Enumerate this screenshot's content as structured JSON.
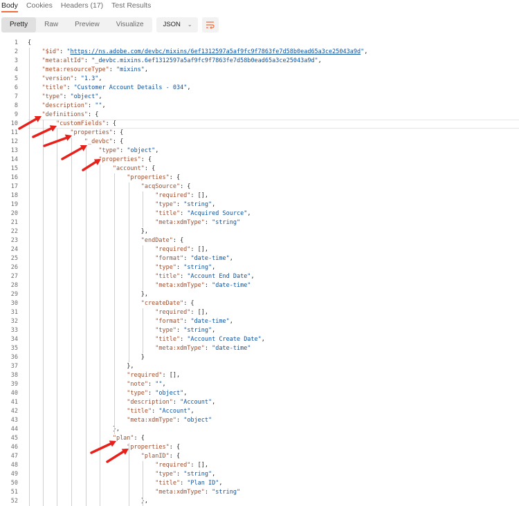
{
  "tabs": [
    "Body",
    "Cookies",
    "Headers (17)",
    "Test Results"
  ],
  "view_modes": [
    "Pretty",
    "Raw",
    "Preview",
    "Visualize"
  ],
  "format": "JSON",
  "colors": {
    "accent": "#f26b3a",
    "arrow": "#e8201a",
    "key": "#a14b2a",
    "string": "#0b52a1"
  },
  "lines": [
    [
      {
        "c": "p",
        "t": "{"
      }
    ],
    [
      {
        "c": "p",
        "t": "    "
      },
      {
        "c": "k",
        "t": "\"$id\""
      },
      {
        "c": "p",
        "t": ": "
      },
      {
        "c": "s",
        "t": "\""
      },
      {
        "c": "u",
        "t": "https://ns.adobe.com/devbc/mixins/6ef1312597a5af9fc9f7863fe7d58b0ead65a3ce25043a9d"
      },
      {
        "c": "s",
        "t": "\""
      },
      {
        "c": "p",
        "t": ","
      }
    ],
    [
      {
        "c": "p",
        "t": "    "
      },
      {
        "c": "k",
        "t": "\"meta:altId\""
      },
      {
        "c": "p",
        "t": ": "
      },
      {
        "c": "s",
        "t": "\"_devbc.mixins.6ef1312597a5af9fc9f7863fe7d58b0ead65a3ce25043a9d\""
      },
      {
        "c": "p",
        "t": ","
      }
    ],
    [
      {
        "c": "p",
        "t": "    "
      },
      {
        "c": "k",
        "t": "\"meta:resourceType\""
      },
      {
        "c": "p",
        "t": ": "
      },
      {
        "c": "s",
        "t": "\"mixins\""
      },
      {
        "c": "p",
        "t": ","
      }
    ],
    [
      {
        "c": "p",
        "t": "    "
      },
      {
        "c": "k",
        "t": "\"version\""
      },
      {
        "c": "p",
        "t": ": "
      },
      {
        "c": "s",
        "t": "\"1.3\""
      },
      {
        "c": "p",
        "t": ","
      }
    ],
    [
      {
        "c": "p",
        "t": "    "
      },
      {
        "c": "k",
        "t": "\"title\""
      },
      {
        "c": "p",
        "t": ": "
      },
      {
        "c": "s",
        "t": "\"Customer Account Details - 034\""
      },
      {
        "c": "p",
        "t": ","
      }
    ],
    [
      {
        "c": "p",
        "t": "    "
      },
      {
        "c": "k",
        "t": "\"type\""
      },
      {
        "c": "p",
        "t": ": "
      },
      {
        "c": "s",
        "t": "\"object\""
      },
      {
        "c": "p",
        "t": ","
      }
    ],
    [
      {
        "c": "p",
        "t": "    "
      },
      {
        "c": "k",
        "t": "\"description\""
      },
      {
        "c": "p",
        "t": ": "
      },
      {
        "c": "s",
        "t": "\"\""
      },
      {
        "c": "p",
        "t": ","
      }
    ],
    [
      {
        "c": "p",
        "t": "    "
      },
      {
        "c": "k",
        "t": "\"definitions\""
      },
      {
        "c": "p",
        "t": ": {"
      }
    ],
    [
      {
        "c": "p",
        "t": "        "
      },
      {
        "c": "k",
        "t": "\"customFields\""
      },
      {
        "c": "p",
        "t": ": {"
      }
    ],
    [
      {
        "c": "p",
        "t": "            "
      },
      {
        "c": "k",
        "t": "\"properties\""
      },
      {
        "c": "p",
        "t": ": {"
      }
    ],
    [
      {
        "c": "p",
        "t": "                "
      },
      {
        "c": "k",
        "t": "\"_devbc\""
      },
      {
        "c": "p",
        "t": ": {"
      }
    ],
    [
      {
        "c": "p",
        "t": "                    "
      },
      {
        "c": "k",
        "t": "\"type\""
      },
      {
        "c": "p",
        "t": ": "
      },
      {
        "c": "s",
        "t": "\"object\""
      },
      {
        "c": "p",
        "t": ","
      }
    ],
    [
      {
        "c": "p",
        "t": "                    "
      },
      {
        "c": "k",
        "t": "\"properties\""
      },
      {
        "c": "p",
        "t": ": {"
      }
    ],
    [
      {
        "c": "p",
        "t": "                        "
      },
      {
        "c": "k",
        "t": "\"account\""
      },
      {
        "c": "p",
        "t": ": {"
      }
    ],
    [
      {
        "c": "p",
        "t": "                            "
      },
      {
        "c": "k",
        "t": "\"properties\""
      },
      {
        "c": "p",
        "t": ": {"
      }
    ],
    [
      {
        "c": "p",
        "t": "                                "
      },
      {
        "c": "k",
        "t": "\"acqSource\""
      },
      {
        "c": "p",
        "t": ": {"
      }
    ],
    [
      {
        "c": "p",
        "t": "                                    "
      },
      {
        "c": "k",
        "t": "\"required\""
      },
      {
        "c": "p",
        "t": ": [],"
      }
    ],
    [
      {
        "c": "p",
        "t": "                                    "
      },
      {
        "c": "k",
        "t": "\"type\""
      },
      {
        "c": "p",
        "t": ": "
      },
      {
        "c": "s",
        "t": "\"string\""
      },
      {
        "c": "p",
        "t": ","
      }
    ],
    [
      {
        "c": "p",
        "t": "                                    "
      },
      {
        "c": "k",
        "t": "\"title\""
      },
      {
        "c": "p",
        "t": ": "
      },
      {
        "c": "s",
        "t": "\"Acquired Source\""
      },
      {
        "c": "p",
        "t": ","
      }
    ],
    [
      {
        "c": "p",
        "t": "                                    "
      },
      {
        "c": "k",
        "t": "\"meta:xdmType\""
      },
      {
        "c": "p",
        "t": ": "
      },
      {
        "c": "s",
        "t": "\"string\""
      }
    ],
    [
      {
        "c": "p",
        "t": "                                },"
      }
    ],
    [
      {
        "c": "p",
        "t": "                                "
      },
      {
        "c": "k",
        "t": "\"endDate\""
      },
      {
        "c": "p",
        "t": ": {"
      }
    ],
    [
      {
        "c": "p",
        "t": "                                    "
      },
      {
        "c": "k",
        "t": "\"required\""
      },
      {
        "c": "p",
        "t": ": [],"
      }
    ],
    [
      {
        "c": "p",
        "t": "                                    "
      },
      {
        "c": "k",
        "t": "\"format\""
      },
      {
        "c": "p",
        "t": ": "
      },
      {
        "c": "s",
        "t": "\"date-time\""
      },
      {
        "c": "p",
        "t": ","
      }
    ],
    [
      {
        "c": "p",
        "t": "                                    "
      },
      {
        "c": "k",
        "t": "\"type\""
      },
      {
        "c": "p",
        "t": ": "
      },
      {
        "c": "s",
        "t": "\"string\""
      },
      {
        "c": "p",
        "t": ","
      }
    ],
    [
      {
        "c": "p",
        "t": "                                    "
      },
      {
        "c": "k",
        "t": "\"title\""
      },
      {
        "c": "p",
        "t": ": "
      },
      {
        "c": "s",
        "t": "\"Account End Date\""
      },
      {
        "c": "p",
        "t": ","
      }
    ],
    [
      {
        "c": "p",
        "t": "                                    "
      },
      {
        "c": "k",
        "t": "\"meta:xdmType\""
      },
      {
        "c": "p",
        "t": ": "
      },
      {
        "c": "s",
        "t": "\"date-time\""
      }
    ],
    [
      {
        "c": "p",
        "t": "                                },"
      }
    ],
    [
      {
        "c": "p",
        "t": "                                "
      },
      {
        "c": "k",
        "t": "\"createDate\""
      },
      {
        "c": "p",
        "t": ": {"
      }
    ],
    [
      {
        "c": "p",
        "t": "                                    "
      },
      {
        "c": "k",
        "t": "\"required\""
      },
      {
        "c": "p",
        "t": ": [],"
      }
    ],
    [
      {
        "c": "p",
        "t": "                                    "
      },
      {
        "c": "k",
        "t": "\"format\""
      },
      {
        "c": "p",
        "t": ": "
      },
      {
        "c": "s",
        "t": "\"date-time\""
      },
      {
        "c": "p",
        "t": ","
      }
    ],
    [
      {
        "c": "p",
        "t": "                                    "
      },
      {
        "c": "k",
        "t": "\"type\""
      },
      {
        "c": "p",
        "t": ": "
      },
      {
        "c": "s",
        "t": "\"string\""
      },
      {
        "c": "p",
        "t": ","
      }
    ],
    [
      {
        "c": "p",
        "t": "                                    "
      },
      {
        "c": "k",
        "t": "\"title\""
      },
      {
        "c": "p",
        "t": ": "
      },
      {
        "c": "s",
        "t": "\"Account Create Date\""
      },
      {
        "c": "p",
        "t": ","
      }
    ],
    [
      {
        "c": "p",
        "t": "                                    "
      },
      {
        "c": "k",
        "t": "\"meta:xdmType\""
      },
      {
        "c": "p",
        "t": ": "
      },
      {
        "c": "s",
        "t": "\"date-time\""
      }
    ],
    [
      {
        "c": "p",
        "t": "                                }"
      }
    ],
    [
      {
        "c": "p",
        "t": "                            },"
      }
    ],
    [
      {
        "c": "p",
        "t": "                            "
      },
      {
        "c": "k",
        "t": "\"required\""
      },
      {
        "c": "p",
        "t": ": [],"
      }
    ],
    [
      {
        "c": "p",
        "t": "                            "
      },
      {
        "c": "k",
        "t": "\"note\""
      },
      {
        "c": "p",
        "t": ": "
      },
      {
        "c": "s",
        "t": "\"\""
      },
      {
        "c": "p",
        "t": ","
      }
    ],
    [
      {
        "c": "p",
        "t": "                            "
      },
      {
        "c": "k",
        "t": "\"type\""
      },
      {
        "c": "p",
        "t": ": "
      },
      {
        "c": "s",
        "t": "\"object\""
      },
      {
        "c": "p",
        "t": ","
      }
    ],
    [
      {
        "c": "p",
        "t": "                            "
      },
      {
        "c": "k",
        "t": "\"description\""
      },
      {
        "c": "p",
        "t": ": "
      },
      {
        "c": "s",
        "t": "\"Account\""
      },
      {
        "c": "p",
        "t": ","
      }
    ],
    [
      {
        "c": "p",
        "t": "                            "
      },
      {
        "c": "k",
        "t": "\"title\""
      },
      {
        "c": "p",
        "t": ": "
      },
      {
        "c": "s",
        "t": "\"Account\""
      },
      {
        "c": "p",
        "t": ","
      }
    ],
    [
      {
        "c": "p",
        "t": "                            "
      },
      {
        "c": "k",
        "t": "\"meta:xdmType\""
      },
      {
        "c": "p",
        "t": ": "
      },
      {
        "c": "s",
        "t": "\"object\""
      }
    ],
    [
      {
        "c": "p",
        "t": "                        },"
      }
    ],
    [
      {
        "c": "p",
        "t": "                        "
      },
      {
        "c": "k",
        "t": "\"plan\""
      },
      {
        "c": "p",
        "t": ": {"
      }
    ],
    [
      {
        "c": "p",
        "t": "                            "
      },
      {
        "c": "k",
        "t": "\"properties\""
      },
      {
        "c": "p",
        "t": ": {"
      }
    ],
    [
      {
        "c": "p",
        "t": "                                "
      },
      {
        "c": "k",
        "t": "\"planID\""
      },
      {
        "c": "p",
        "t": ": {"
      }
    ],
    [
      {
        "c": "p",
        "t": "                                    "
      },
      {
        "c": "k",
        "t": "\"required\""
      },
      {
        "c": "p",
        "t": ": [],"
      }
    ],
    [
      {
        "c": "p",
        "t": "                                    "
      },
      {
        "c": "k",
        "t": "\"type\""
      },
      {
        "c": "p",
        "t": ": "
      },
      {
        "c": "s",
        "t": "\"string\""
      },
      {
        "c": "p",
        "t": ","
      }
    ],
    [
      {
        "c": "p",
        "t": "                                    "
      },
      {
        "c": "k",
        "t": "\"title\""
      },
      {
        "c": "p",
        "t": ": "
      },
      {
        "c": "s",
        "t": "\"Plan ID\""
      },
      {
        "c": "p",
        "t": ","
      }
    ],
    [
      {
        "c": "p",
        "t": "                                    "
      },
      {
        "c": "k",
        "t": "\"meta:xdmType\""
      },
      {
        "c": "p",
        "t": ": "
      },
      {
        "c": "s",
        "t": "\"string\""
      }
    ],
    [
      {
        "c": "p",
        "t": "                                },"
      }
    ]
  ]
}
